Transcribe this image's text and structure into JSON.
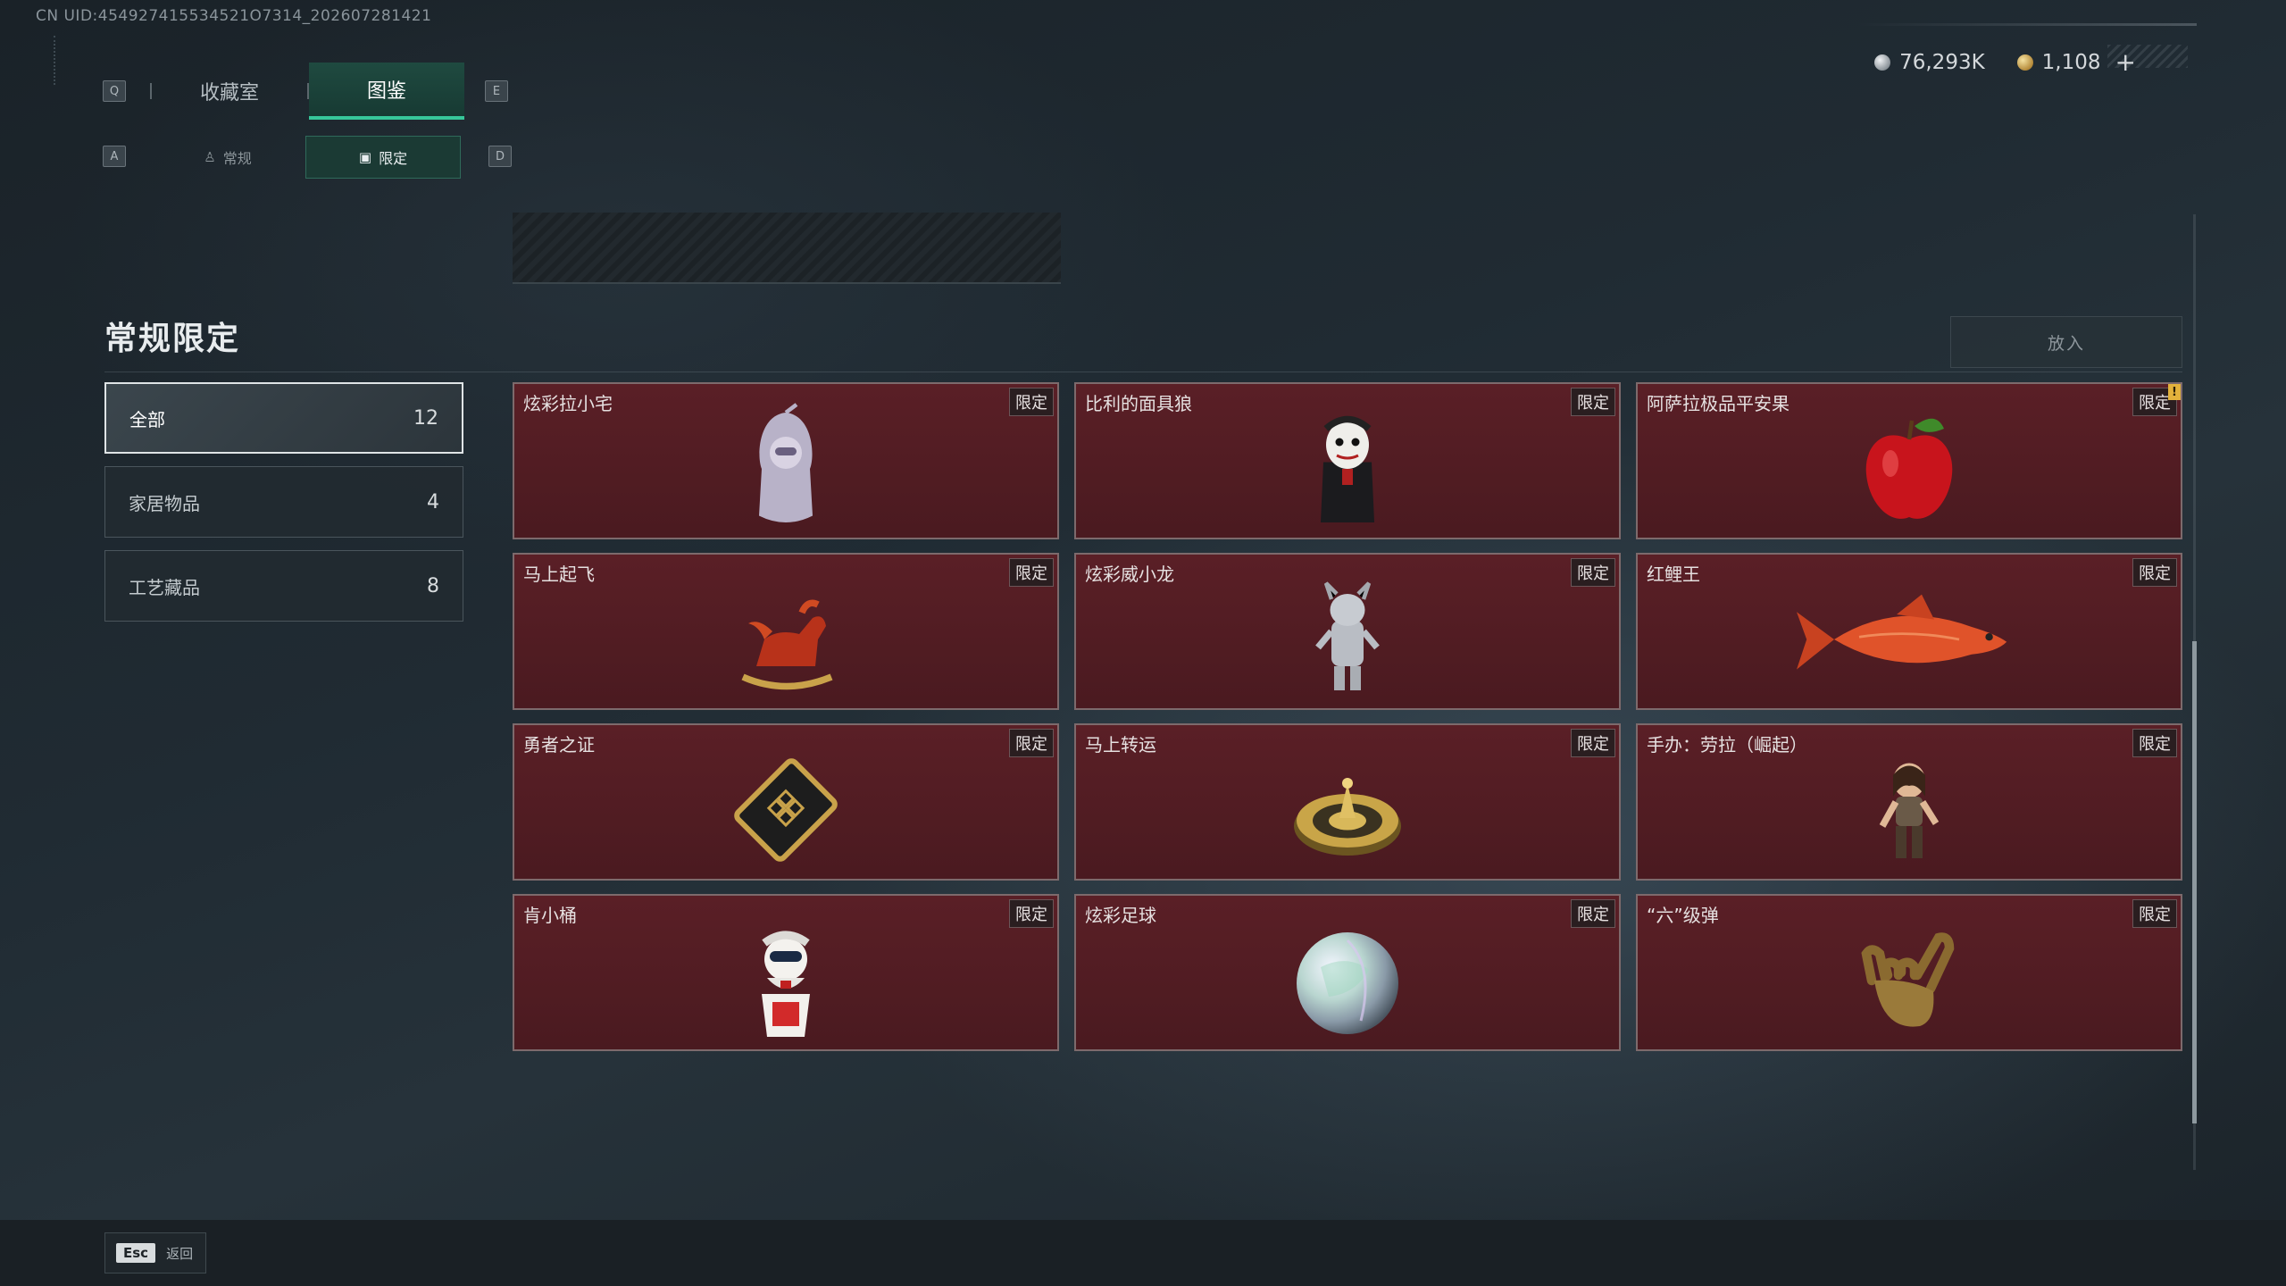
{
  "uid_text": "CN UID:454927415534521O7314_202607281421",
  "currency": {
    "silver": "76,293K",
    "gold": "1,108",
    "plus": "+",
    "silver_icon": "silver-coin-icon",
    "gold_icon": "gold-coin-icon"
  },
  "key_hints": {
    "prev_tab": "Q",
    "next_tab": "E",
    "prev_sub": "A",
    "next_sub": "D"
  },
  "tabs": [
    {
      "label": "收藏室",
      "active": false
    },
    {
      "label": "图鉴",
      "active": true
    }
  ],
  "sub_tabs": [
    {
      "label": "常规",
      "icon": "figure-icon",
      "active": false
    },
    {
      "label": "限定",
      "icon": "image-icon",
      "active": true
    }
  ],
  "section_title": "常规限定",
  "put_in_button": "放入",
  "categories": [
    {
      "label": "全部",
      "count": "12",
      "active": true
    },
    {
      "label": "家居物品",
      "count": "4",
      "active": false
    },
    {
      "label": "工艺藏品",
      "count": "8",
      "active": false
    }
  ],
  "items": [
    {
      "name": "炫彩拉小宅",
      "tag": "限定",
      "icon": "hooded-figurine-icon"
    },
    {
      "name": "比利的面具狼",
      "tag": "限定",
      "icon": "masked-puppet-icon"
    },
    {
      "name": "阿萨拉极品平安果",
      "tag": "限定",
      "icon": "red-apple-icon",
      "warning": "!"
    },
    {
      "name": "马上起飞",
      "tag": "限定",
      "icon": "rocking-horse-icon"
    },
    {
      "name": "炫彩威小龙",
      "tag": "限定",
      "icon": "dragon-figurine-icon"
    },
    {
      "name": "红鲤王",
      "tag": "限定",
      "icon": "red-carp-icon"
    },
    {
      "name": "勇者之证",
      "tag": "限定",
      "icon": "badge-plate-icon"
    },
    {
      "name": "马上转运",
      "tag": "限定",
      "icon": "golden-compass-icon"
    },
    {
      "name": "手办：劳拉（崛起）",
      "tag": "限定",
      "icon": "lara-figure-icon"
    },
    {
      "name": "肯小桶",
      "tag": "限定",
      "icon": "bucket-mascot-icon"
    },
    {
      "name": "炫彩足球",
      "tag": "限定",
      "icon": "iridescent-ball-icon"
    },
    {
      "name": "“六”级弹",
      "tag": "限定",
      "icon": "golden-hand-icon"
    }
  ],
  "back": {
    "key": "Esc",
    "label": "返回"
  }
}
